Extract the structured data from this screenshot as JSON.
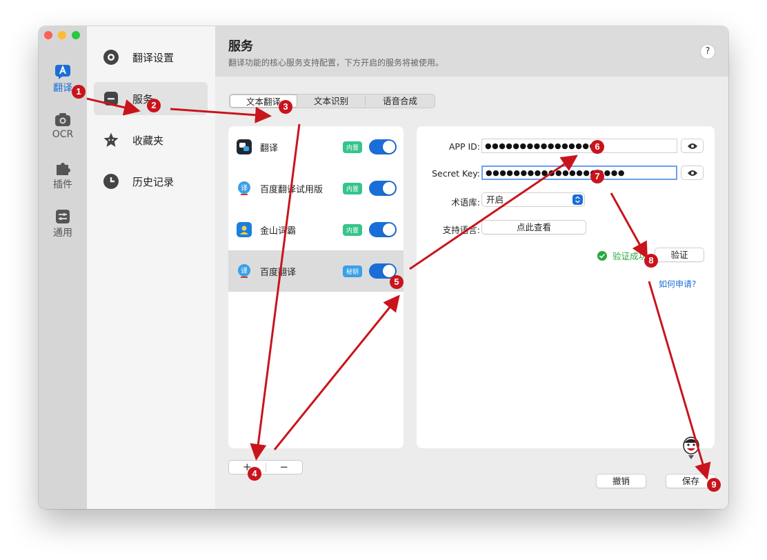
{
  "rail": {
    "items": [
      {
        "label": "翻译",
        "icon": "translate-icon"
      },
      {
        "label": "OCR",
        "icon": "camera-icon"
      },
      {
        "label": "插件",
        "icon": "puzzle-icon"
      },
      {
        "label": "通用",
        "icon": "sliders-icon"
      }
    ]
  },
  "sidebar": {
    "items": [
      {
        "label": "翻译设置",
        "icon": "gear-icon"
      },
      {
        "label": "服务",
        "icon": "service-icon"
      },
      {
        "label": "收藏夹",
        "icon": "star-icon"
      },
      {
        "label": "历史记录",
        "icon": "clock-icon"
      }
    ]
  },
  "header": {
    "title": "服务",
    "subtitle": "翻译功能的核心服务支持配置，下方开启的服务将被使用。",
    "help_label": "?"
  },
  "tabs": [
    "文本翻译",
    "文本识别",
    "语音合成"
  ],
  "services": [
    {
      "name": "翻译",
      "badge": "内置",
      "enabled": true
    },
    {
      "name": "百度翻译试用版",
      "badge": "内置",
      "enabled": true
    },
    {
      "name": "金山词霸",
      "badge": "内置",
      "enabled": true
    },
    {
      "name": "百度翻译",
      "badge": "秘钥",
      "enabled": true
    }
  ],
  "list_controls": {
    "add": "+",
    "remove": "−"
  },
  "form": {
    "app_id_label": "APP ID:",
    "app_id_value": "●●●●●●●●●●●●●●●●●",
    "secret_key_label": "Secret Key:",
    "secret_key_value": "●●●●●●●●●●●●●●●●●●●●",
    "term_label": "术语库:",
    "term_value": "开启",
    "lang_label": "支持语言:",
    "lang_button": "点此查看",
    "verified_text": "验证成功",
    "verify_button": "验证",
    "apply_link": "如何申请?"
  },
  "footer": {
    "cancel": "撤销",
    "save": "保存"
  },
  "annotations": [
    "1",
    "2",
    "3",
    "4",
    "5",
    "6",
    "7",
    "8",
    "9"
  ],
  "colors": {
    "accent": "#1a6ed8",
    "annotation": "#c9141c",
    "success": "#2aa841"
  }
}
